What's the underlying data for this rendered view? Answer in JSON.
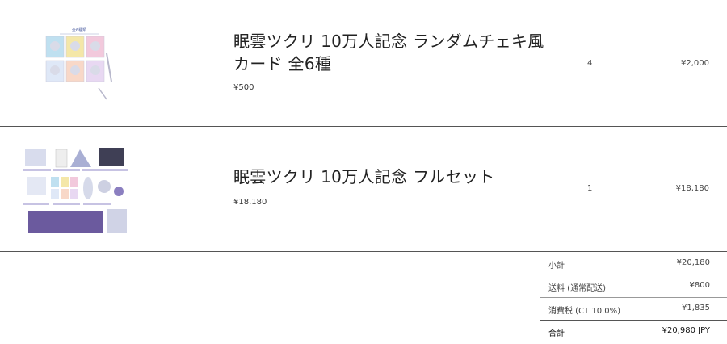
{
  "items": [
    {
      "title_line1": "眠雲ツクリ 10万人記念 ランダムチェキ風",
      "title_line2": "カード 全6種",
      "price": "¥500",
      "quantity": "4",
      "line_total": "¥2,000",
      "thumbnail_icon": "cheki-card-set-thumbnail",
      "thumbnail_heading": "全6種類"
    },
    {
      "title_line1": "眠雲ツクリ 10万人記念 フルセット",
      "price": "¥18,180",
      "quantity": "1",
      "line_total": "¥18,180",
      "thumbnail_icon": "full-set-merch-thumbnail"
    }
  ],
  "summary": {
    "subtotal_label": "小計",
    "subtotal_value": "¥20,180",
    "shipping_label": "送料 (通常配送)",
    "shipping_value": "¥800",
    "tax_label": "消費税 (CT 10.0%)",
    "tax_value": "¥1,835",
    "total_label": "合計",
    "total_value": "¥20,980 JPY"
  },
  "colors": {
    "border": "#555555",
    "card_pink": "#f2c9dc",
    "card_blue": "#bfe0f0",
    "card_yellow": "#f4e7a8",
    "banner_purple": "#6b5a9e"
  }
}
